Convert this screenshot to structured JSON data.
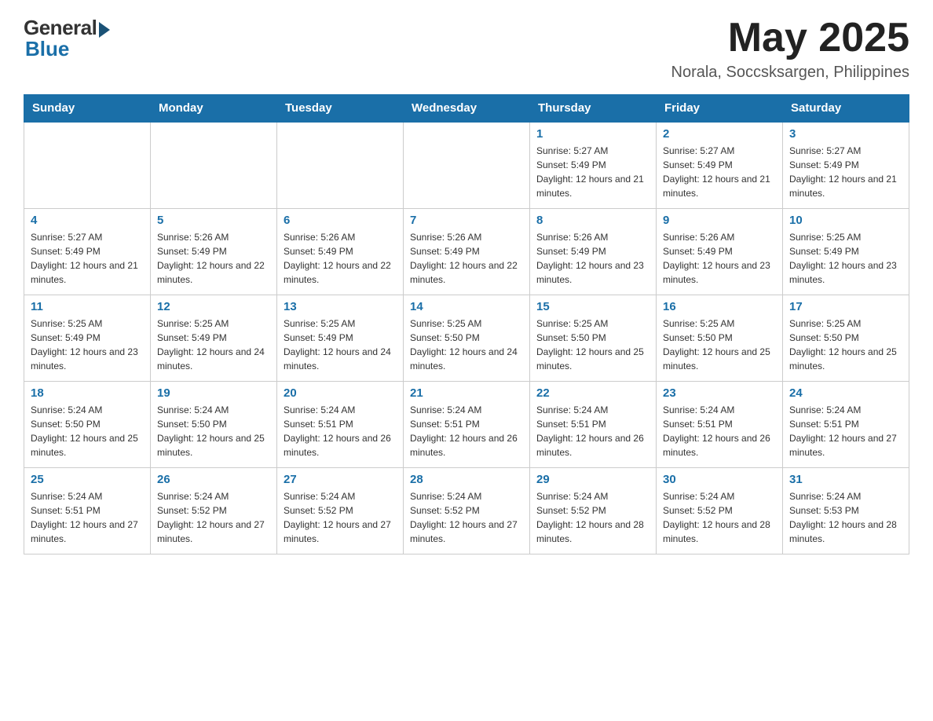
{
  "header": {
    "logo_general": "General",
    "logo_blue": "Blue",
    "month_year": "May 2025",
    "location": "Norala, Soccsksargen, Philippines"
  },
  "days_of_week": [
    "Sunday",
    "Monday",
    "Tuesday",
    "Wednesday",
    "Thursday",
    "Friday",
    "Saturday"
  ],
  "weeks": [
    [
      {
        "day": "",
        "sunrise": "",
        "sunset": "",
        "daylight": ""
      },
      {
        "day": "",
        "sunrise": "",
        "sunset": "",
        "daylight": ""
      },
      {
        "day": "",
        "sunrise": "",
        "sunset": "",
        "daylight": ""
      },
      {
        "day": "",
        "sunrise": "",
        "sunset": "",
        "daylight": ""
      },
      {
        "day": "1",
        "sunrise": "Sunrise: 5:27 AM",
        "sunset": "Sunset: 5:49 PM",
        "daylight": "Daylight: 12 hours and 21 minutes."
      },
      {
        "day": "2",
        "sunrise": "Sunrise: 5:27 AM",
        "sunset": "Sunset: 5:49 PM",
        "daylight": "Daylight: 12 hours and 21 minutes."
      },
      {
        "day": "3",
        "sunrise": "Sunrise: 5:27 AM",
        "sunset": "Sunset: 5:49 PM",
        "daylight": "Daylight: 12 hours and 21 minutes."
      }
    ],
    [
      {
        "day": "4",
        "sunrise": "Sunrise: 5:27 AM",
        "sunset": "Sunset: 5:49 PM",
        "daylight": "Daylight: 12 hours and 21 minutes."
      },
      {
        "day": "5",
        "sunrise": "Sunrise: 5:26 AM",
        "sunset": "Sunset: 5:49 PM",
        "daylight": "Daylight: 12 hours and 22 minutes."
      },
      {
        "day": "6",
        "sunrise": "Sunrise: 5:26 AM",
        "sunset": "Sunset: 5:49 PM",
        "daylight": "Daylight: 12 hours and 22 minutes."
      },
      {
        "day": "7",
        "sunrise": "Sunrise: 5:26 AM",
        "sunset": "Sunset: 5:49 PM",
        "daylight": "Daylight: 12 hours and 22 minutes."
      },
      {
        "day": "8",
        "sunrise": "Sunrise: 5:26 AM",
        "sunset": "Sunset: 5:49 PM",
        "daylight": "Daylight: 12 hours and 23 minutes."
      },
      {
        "day": "9",
        "sunrise": "Sunrise: 5:26 AM",
        "sunset": "Sunset: 5:49 PM",
        "daylight": "Daylight: 12 hours and 23 minutes."
      },
      {
        "day": "10",
        "sunrise": "Sunrise: 5:25 AM",
        "sunset": "Sunset: 5:49 PM",
        "daylight": "Daylight: 12 hours and 23 minutes."
      }
    ],
    [
      {
        "day": "11",
        "sunrise": "Sunrise: 5:25 AM",
        "sunset": "Sunset: 5:49 PM",
        "daylight": "Daylight: 12 hours and 23 minutes."
      },
      {
        "day": "12",
        "sunrise": "Sunrise: 5:25 AM",
        "sunset": "Sunset: 5:49 PM",
        "daylight": "Daylight: 12 hours and 24 minutes."
      },
      {
        "day": "13",
        "sunrise": "Sunrise: 5:25 AM",
        "sunset": "Sunset: 5:49 PM",
        "daylight": "Daylight: 12 hours and 24 minutes."
      },
      {
        "day": "14",
        "sunrise": "Sunrise: 5:25 AM",
        "sunset": "Sunset: 5:50 PM",
        "daylight": "Daylight: 12 hours and 24 minutes."
      },
      {
        "day": "15",
        "sunrise": "Sunrise: 5:25 AM",
        "sunset": "Sunset: 5:50 PM",
        "daylight": "Daylight: 12 hours and 25 minutes."
      },
      {
        "day": "16",
        "sunrise": "Sunrise: 5:25 AM",
        "sunset": "Sunset: 5:50 PM",
        "daylight": "Daylight: 12 hours and 25 minutes."
      },
      {
        "day": "17",
        "sunrise": "Sunrise: 5:25 AM",
        "sunset": "Sunset: 5:50 PM",
        "daylight": "Daylight: 12 hours and 25 minutes."
      }
    ],
    [
      {
        "day": "18",
        "sunrise": "Sunrise: 5:24 AM",
        "sunset": "Sunset: 5:50 PM",
        "daylight": "Daylight: 12 hours and 25 minutes."
      },
      {
        "day": "19",
        "sunrise": "Sunrise: 5:24 AM",
        "sunset": "Sunset: 5:50 PM",
        "daylight": "Daylight: 12 hours and 25 minutes."
      },
      {
        "day": "20",
        "sunrise": "Sunrise: 5:24 AM",
        "sunset": "Sunset: 5:51 PM",
        "daylight": "Daylight: 12 hours and 26 minutes."
      },
      {
        "day": "21",
        "sunrise": "Sunrise: 5:24 AM",
        "sunset": "Sunset: 5:51 PM",
        "daylight": "Daylight: 12 hours and 26 minutes."
      },
      {
        "day": "22",
        "sunrise": "Sunrise: 5:24 AM",
        "sunset": "Sunset: 5:51 PM",
        "daylight": "Daylight: 12 hours and 26 minutes."
      },
      {
        "day": "23",
        "sunrise": "Sunrise: 5:24 AM",
        "sunset": "Sunset: 5:51 PM",
        "daylight": "Daylight: 12 hours and 26 minutes."
      },
      {
        "day": "24",
        "sunrise": "Sunrise: 5:24 AM",
        "sunset": "Sunset: 5:51 PM",
        "daylight": "Daylight: 12 hours and 27 minutes."
      }
    ],
    [
      {
        "day": "25",
        "sunrise": "Sunrise: 5:24 AM",
        "sunset": "Sunset: 5:51 PM",
        "daylight": "Daylight: 12 hours and 27 minutes."
      },
      {
        "day": "26",
        "sunrise": "Sunrise: 5:24 AM",
        "sunset": "Sunset: 5:52 PM",
        "daylight": "Daylight: 12 hours and 27 minutes."
      },
      {
        "day": "27",
        "sunrise": "Sunrise: 5:24 AM",
        "sunset": "Sunset: 5:52 PM",
        "daylight": "Daylight: 12 hours and 27 minutes."
      },
      {
        "day": "28",
        "sunrise": "Sunrise: 5:24 AM",
        "sunset": "Sunset: 5:52 PM",
        "daylight": "Daylight: 12 hours and 27 minutes."
      },
      {
        "day": "29",
        "sunrise": "Sunrise: 5:24 AM",
        "sunset": "Sunset: 5:52 PM",
        "daylight": "Daylight: 12 hours and 28 minutes."
      },
      {
        "day": "30",
        "sunrise": "Sunrise: 5:24 AM",
        "sunset": "Sunset: 5:52 PM",
        "daylight": "Daylight: 12 hours and 28 minutes."
      },
      {
        "day": "31",
        "sunrise": "Sunrise: 5:24 AM",
        "sunset": "Sunset: 5:53 PM",
        "daylight": "Daylight: 12 hours and 28 minutes."
      }
    ]
  ]
}
